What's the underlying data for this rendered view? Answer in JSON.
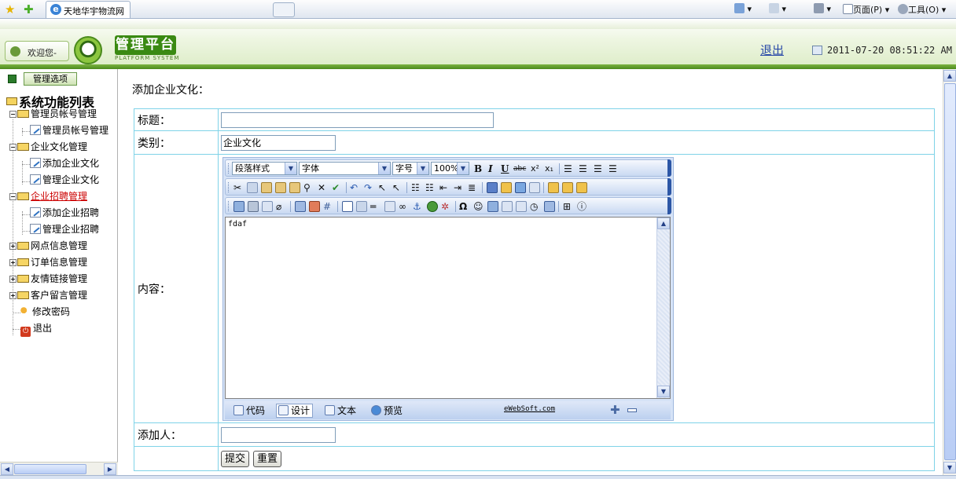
{
  "browser": {
    "tab_title": "天地华宇物流网",
    "commands": {
      "page": "页面(P)",
      "tools": "工具(O)"
    }
  },
  "header": {
    "welcome": "欢迎您-",
    "brand": "管理平台",
    "brand_sub": "PLATFORM SYSTEM",
    "logout": "退出",
    "datetime": "2011-07-20 08:51:22 AM"
  },
  "sidebar": {
    "options_button": "管理选项",
    "tree_root": "系统功能列表",
    "items": [
      {
        "label": "管理员帐号管理",
        "type": "folder",
        "expanded": true
      },
      {
        "label": "管理员帐号管理",
        "type": "leaf"
      },
      {
        "label": "企业文化管理",
        "type": "folder",
        "expanded": true
      },
      {
        "label": "添加企业文化",
        "type": "leaf"
      },
      {
        "label": "管理企业文化",
        "type": "leaf"
      },
      {
        "label": "企业招聘管理",
        "type": "folder",
        "expanded": true,
        "active": true
      },
      {
        "label": "添加企业招聘",
        "type": "leaf"
      },
      {
        "label": "管理企业招聘",
        "type": "leaf"
      },
      {
        "label": "网点信息管理",
        "type": "folder",
        "expanded": false
      },
      {
        "label": "订单信息管理",
        "type": "folder",
        "expanded": false
      },
      {
        "label": "友情链接管理",
        "type": "folder",
        "expanded": false
      },
      {
        "label": "客户留言管理",
        "type": "folder",
        "expanded": false
      },
      {
        "label": "修改密码",
        "type": "key"
      },
      {
        "label": "退出",
        "type": "exit"
      }
    ]
  },
  "form": {
    "title": "添加企业文化：",
    "fields": {
      "title_label": "标题：",
      "title_value": "",
      "category_label": "类别：",
      "category_value": "企业文化",
      "content_label": "内容：",
      "author_label": "添加人：",
      "author_value": ""
    },
    "buttons": {
      "submit": "提交",
      "reset": "重置"
    }
  },
  "editor": {
    "paragraph_style": "段落样式",
    "font": "字体",
    "font_size": "字号",
    "zoom": "100%",
    "content": "fdaf",
    "modes": {
      "code": "代码",
      "design": "设计",
      "text": "文本",
      "preview": "预览"
    },
    "credit": "eWebSoft.com"
  }
}
